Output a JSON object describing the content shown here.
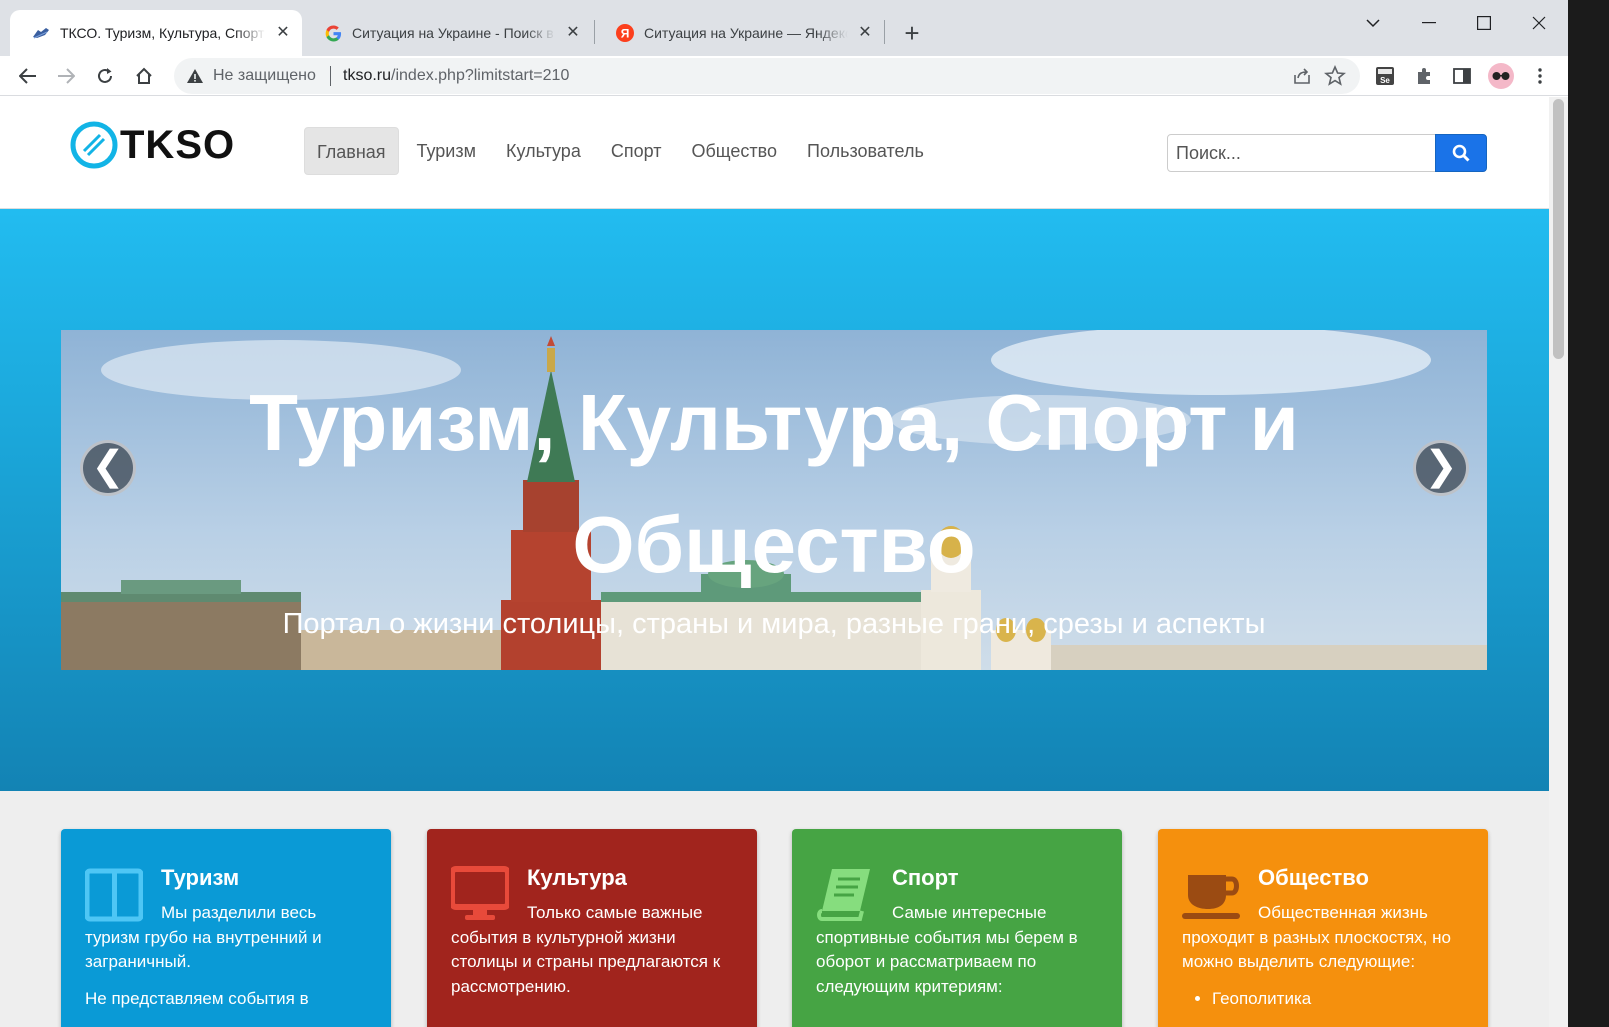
{
  "browser": {
    "tabs": [
      {
        "title": "ТКСО. Туризм, Культура, Спорт и Общество",
        "favicon": "shoe-icon",
        "active": true
      },
      {
        "title": "Ситуация на Украине - Поиск в Google",
        "favicon": "google-icon",
        "active": false
      },
      {
        "title": "Ситуация на Украине — Яндекс",
        "favicon": "yandex-icon",
        "active": false
      }
    ],
    "omnibox": {
      "security_label": "Не защищено",
      "host": "tkso.ru",
      "path": "/index.php?limitstart=210"
    }
  },
  "site": {
    "logo_text": "TKSO",
    "nav": [
      "Главная",
      "Туризм",
      "Культура",
      "Спорт",
      "Общество",
      "Пользователь"
    ],
    "search_placeholder": "Поиск...",
    "hero": {
      "title": "Туризм, Культура, Спорт и Общество",
      "subtitle": "Портал о жизни столицы, страны и мира,  разные грани, срезы и аспекты",
      "prev_arrow": "❮",
      "next_arrow": "❯"
    },
    "features": [
      {
        "title": "Туризм",
        "color": "#0a9ad6",
        "icon": "columns-icon",
        "text": "Мы разделили весь туризм грубо на внутренний и заграничный.",
        "text2": "Не представляем события в"
      },
      {
        "title": "Культура",
        "color": "#a1241d",
        "icon": "monitor-icon",
        "text": "Только самые важные события в культурной жизни столицы и страны предлагаются к рассмотрению.",
        "text2": ""
      },
      {
        "title": "Спорт",
        "color": "#46a444",
        "icon": "book-icon",
        "text": "Самые интересные спортивные события мы берем в оборот и рассматриваем по следующим критериям:",
        "text2": ""
      },
      {
        "title": "Общество",
        "color": "#f5900d",
        "icon": "coffee-cup-icon",
        "text": "Общественная жизнь проходит в разных плоскостях, но можно выделить следующие:",
        "list": [
          "Геополитика"
        ]
      }
    ]
  }
}
